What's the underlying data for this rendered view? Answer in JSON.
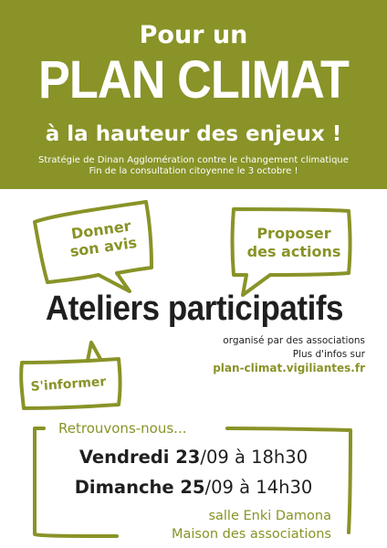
{
  "header": {
    "line1": "Pour un",
    "line2": "PLAN CLIMAT",
    "line3": "à la hauteur des enjeux !",
    "sub1": "Stratégie de Dinan Agglomération contre le changement climatique",
    "sub2": "Fin de la consultation citoyenne le 3 octobre !"
  },
  "bubbles": {
    "donner": [
      "Donner",
      "son avis"
    ],
    "proposer": [
      "Proposer",
      "des actions"
    ],
    "informer": "S'informer"
  },
  "ateliers": "Ateliers participatifs",
  "info": {
    "organise": "organisé par des associations",
    "plus": "Plus d'infos sur",
    "url": "plan-climat.vigiliantes.fr"
  },
  "event": {
    "retrouvons": "Retrouvons-nous...",
    "date1": {
      "day": "Vendredi 23",
      "rest": "/09 à 18h30"
    },
    "date2": {
      "day": "Dimanche 25",
      "rest": "/09 à 14h30"
    },
    "salle": "salle Enki Damona",
    "maison": "Maison des associations"
  },
  "colors": {
    "accent": "#899327",
    "text": "#1f1f1f",
    "background": "#ffffff"
  }
}
